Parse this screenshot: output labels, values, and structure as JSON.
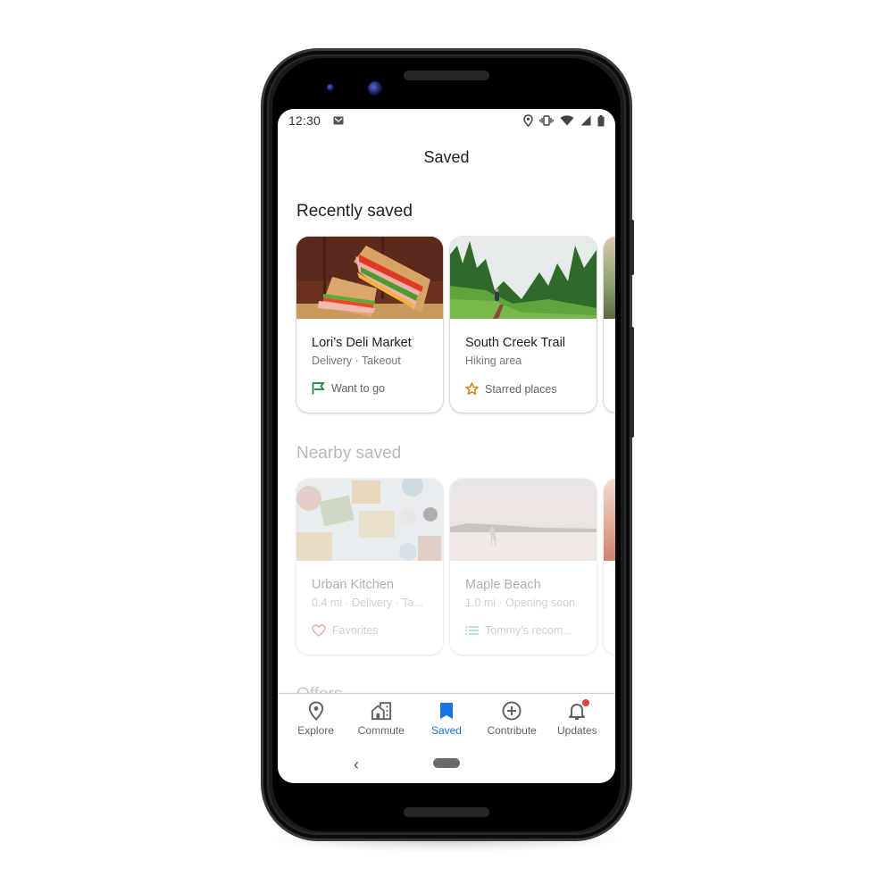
{
  "status_bar": {
    "time": "12:30",
    "icons": [
      "gmail-icon",
      "location-icon",
      "vibrate-icon",
      "wifi-icon",
      "signal-icon",
      "battery-icon"
    ]
  },
  "header": {
    "title": "Saved"
  },
  "sections": {
    "recent": {
      "title": "Recently saved",
      "cards": [
        {
          "title": "Lori’s Deli Market",
          "subtitle": "Delivery · Takeout",
          "list_label": "Want to go",
          "list_icon": "flag-icon",
          "icon_color": "#188038"
        },
        {
          "title": "South Creek Trail",
          "subtitle": "Hiking area",
          "list_label": "Starred places",
          "list_icon": "star-icon",
          "icon_color": "#e37400"
        }
      ]
    },
    "nearby": {
      "title": "Nearby saved",
      "cards": [
        {
          "title": "Urban Kitchen",
          "subtitle": "0.4 mi · Delivery · Ta...",
          "list_label": "Favorites",
          "list_icon": "heart-icon",
          "icon_color": "#f2a7a1"
        },
        {
          "title": "Maple Beach",
          "subtitle": "1.0 mi · Opening soon",
          "list_label": "Tommy’s recom...",
          "list_icon": "list-icon",
          "icon_color": "#9fd6e6"
        }
      ]
    },
    "offers": {
      "title": "Offers"
    }
  },
  "bottom_nav": {
    "items": [
      {
        "label": "Explore",
        "icon": "location-pin-icon"
      },
      {
        "label": "Commute",
        "icon": "commute-icon"
      },
      {
        "label": "Saved",
        "icon": "bookmark-icon",
        "active": true
      },
      {
        "label": "Contribute",
        "icon": "add-circle-icon"
      },
      {
        "label": "Updates",
        "icon": "bell-icon",
        "has_notification": true
      }
    ],
    "active_color": "#1a73e8"
  },
  "system_nav": {
    "back_glyph": "‹"
  }
}
